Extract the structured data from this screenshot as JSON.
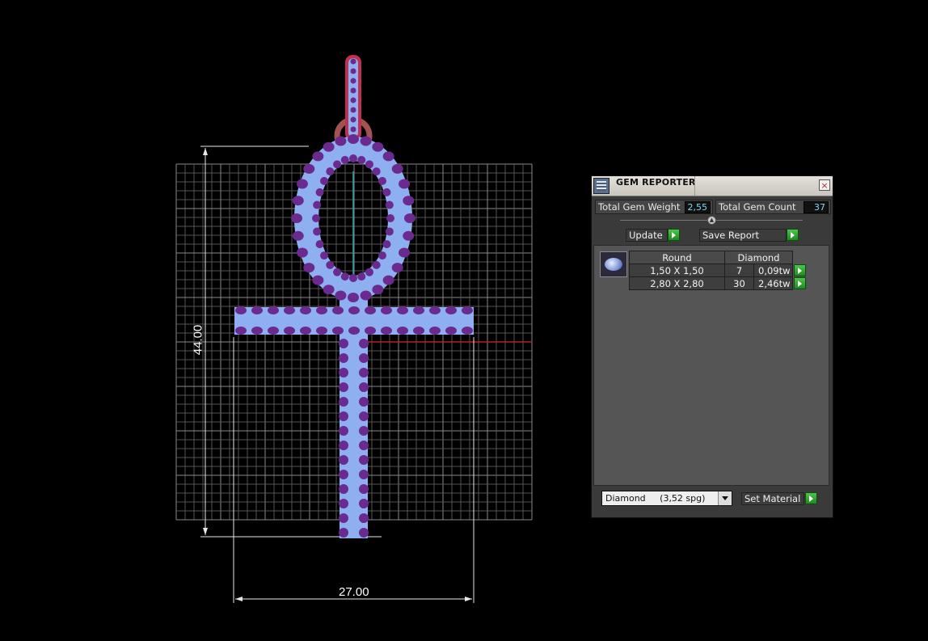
{
  "viewport": {
    "dimension_width": "27.00",
    "dimension_height": "44.00"
  },
  "panel": {
    "title": "GEM REPORTER",
    "close_icon": "×",
    "total_gem_weight_label": "Total Gem Weight",
    "total_gem_weight_value": "2,55",
    "total_gem_count_label": "Total Gem Count",
    "total_gem_count_value": "37",
    "update_label": "Update",
    "save_report_label": "Save Report",
    "table": {
      "headers": [
        "Round",
        "Diamond"
      ],
      "rows": [
        {
          "size": "1,50 X 1,50",
          "count": "7",
          "weight": "0,09tw"
        },
        {
          "size": "2,80 X 2,80",
          "count": "30",
          "weight": "2,46tw"
        }
      ]
    },
    "material_value": "Diamond     (3,52 spg)",
    "set_material_label": "Set Material"
  }
}
